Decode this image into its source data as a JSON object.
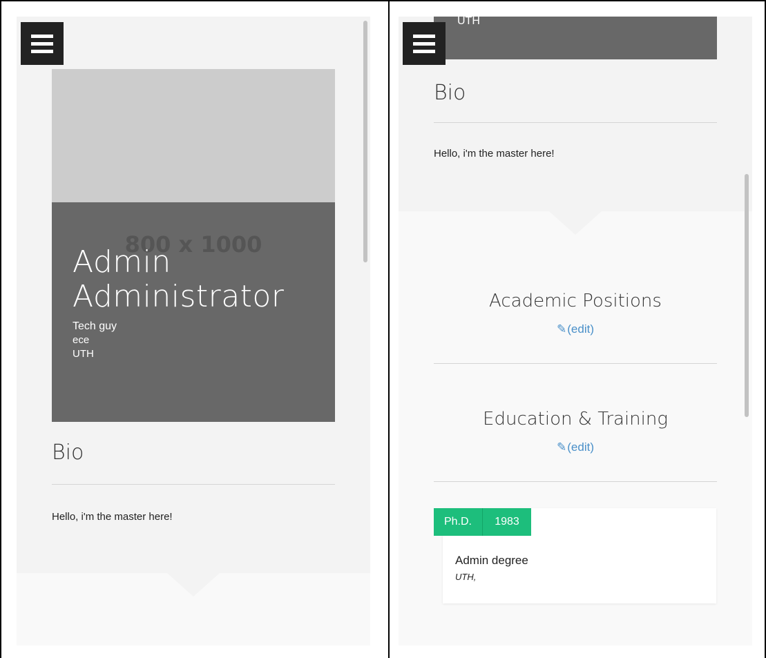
{
  "left_screen": {
    "menu_icon": "hamburger-menu-icon",
    "photo_placeholder": "800 x 1000",
    "name_first": "Admin",
    "name_last": "Administrator",
    "role": "Tech guy",
    "department": "ece",
    "institution": "UTH",
    "bio_title": "Bio",
    "bio_text": "Hello, i'm the master here!"
  },
  "right_screen": {
    "menu_icon": "hamburger-menu-icon",
    "top_partial_text": "UTH",
    "bio_title": "Bio",
    "bio_text": "Hello, i'm the master here!",
    "academic_positions_title": "Academic Positions",
    "academic_positions_edit": "(edit)",
    "education_title": "Education & Training",
    "education_edit": "(edit)",
    "education_entries": [
      {
        "degree": "Ph.D.",
        "year": "1983",
        "title": "Admin degree",
        "school": "UTH,"
      }
    ]
  },
  "colors": {
    "dark_panel": "#686868",
    "photo_placeholder": "#cccccc",
    "badge_green": "#1dbe7c",
    "link_blue": "#4a90c9",
    "menu_button": "#222222"
  }
}
